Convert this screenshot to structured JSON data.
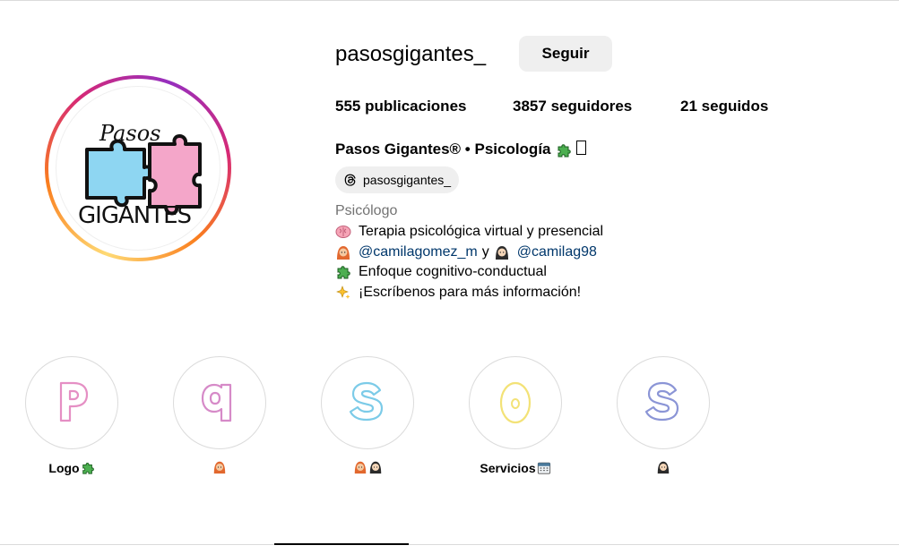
{
  "profile": {
    "username": "pasosgigantes_",
    "follow_label": "Seguir",
    "stats": {
      "posts_count": "555",
      "posts_label": "publicaciones",
      "followers_count": "3857",
      "followers_label": "seguidores",
      "following_count": "21",
      "following_label": "seguidos"
    },
    "full_name": "Pasos Gigantes® • Psicología",
    "threads_handle": "pasosgigantes_",
    "category": "Psicólogo",
    "bio": {
      "line1": "Terapia psicológica virtual y presencial",
      "mention1": "@camilagomez_m",
      "connector": "y",
      "mention2": "@camilag98",
      "line3": "Enfoque cognitivo-conductual",
      "line4": "¡Escríbenos para más información!"
    },
    "avatar_logo": {
      "word1": "Pasos",
      "word2": "GIGANTES"
    }
  },
  "highlights": [
    {
      "letter": "p",
      "label": "Logo",
      "emojis": [
        "puzzle"
      ],
      "color": "#e58fc4"
    },
    {
      "letter": "q",
      "label": "",
      "emojis": [
        "woman-red"
      ],
      "color": "#d68ac8"
    },
    {
      "letter": "s",
      "label": "",
      "emojis": [
        "woman-red",
        "woman-dark"
      ],
      "color": "#7ccbe8"
    },
    {
      "letter": "o",
      "label": "Servicios",
      "emojis": [
        "calendar"
      ],
      "color": "#f3e277"
    },
    {
      "letter": "s",
      "label": "",
      "emojis": [
        "woman-dark"
      ],
      "color": "#8b95d6"
    }
  ],
  "colors": {
    "mention": "#00376b",
    "muted": "#737373",
    "button_bg": "#efefef",
    "puzzle_blue": "#8ed6f2",
    "puzzle_pink": "#f4a6c9"
  },
  "icons": [
    "threads-icon",
    "brain-icon",
    "woman-red-hair-icon",
    "woman-dark-hair-icon",
    "puzzle-icon",
    "sparkles-icon",
    "calendar-icon"
  ]
}
